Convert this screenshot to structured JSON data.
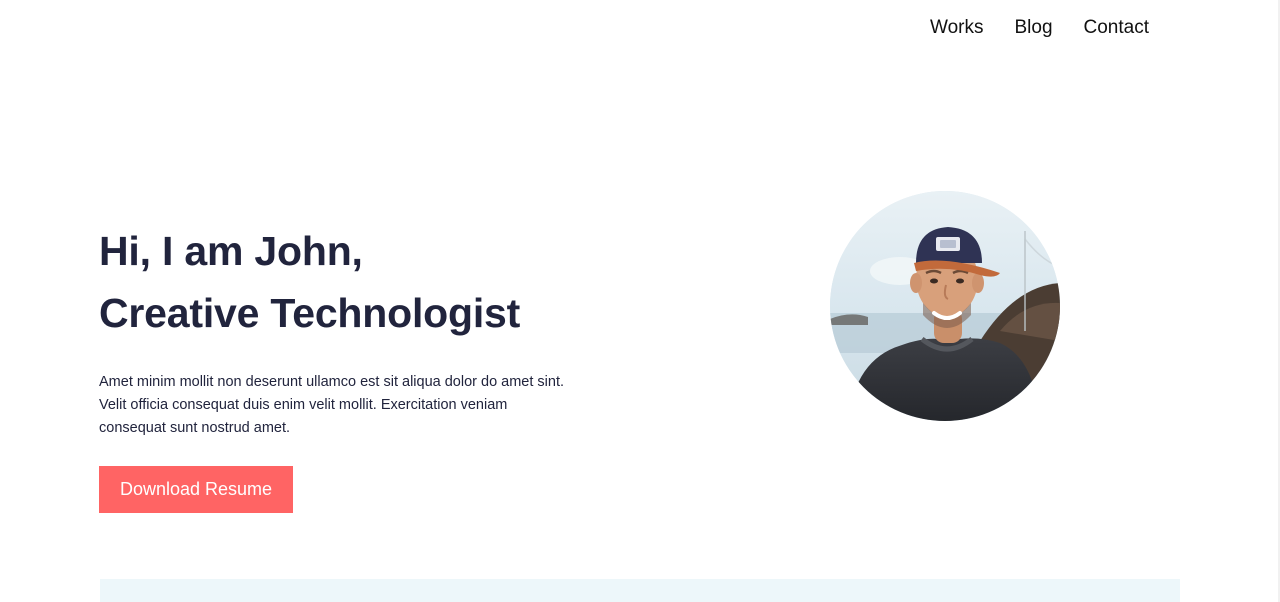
{
  "nav": {
    "items": [
      {
        "label": "Works"
      },
      {
        "label": "Blog"
      },
      {
        "label": "Contact"
      }
    ]
  },
  "hero": {
    "title_line1": "Hi, I am John,",
    "title_line2": "Creative Technologist",
    "description": "Amet minim mollit non deserunt ullamco est sit aliqua dolor do amet sint. Velit officia consequat duis enim velit mollit. Exercitation veniam consequat sunt nostrud amet.",
    "button_label": "Download Resume"
  },
  "colors": {
    "accent": "#ff6464",
    "heading": "#21243d",
    "section_band": "#edf7fa"
  },
  "icons": {
    "avatar": "profile-photo"
  }
}
